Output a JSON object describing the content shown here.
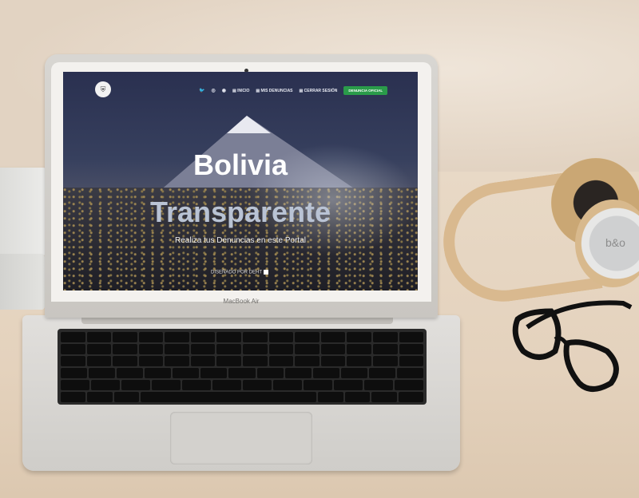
{
  "device": {
    "brand": "MacBook Air"
  },
  "site": {
    "nav": {
      "logo_icon": "shield-icon",
      "social": [
        "twitter-icon",
        "instagram-icon-1",
        "instagram-icon-2"
      ],
      "links": [
        {
          "label": "INICIO",
          "icon": "home-icon"
        },
        {
          "label": "MIS DENUNCIAS",
          "icon": "list-icon"
        },
        {
          "label": "CERRAR SESIÓN",
          "icon": "logout-icon"
        }
      ],
      "cta": "DENUNCIA OFICIAL"
    },
    "hero": {
      "title_line1": "Bolivia",
      "title_line2": "Transparente",
      "subtitle": "Realiza tus Denuncias en este Portal",
      "credit": "DISEÑADO POR DEHT"
    }
  }
}
